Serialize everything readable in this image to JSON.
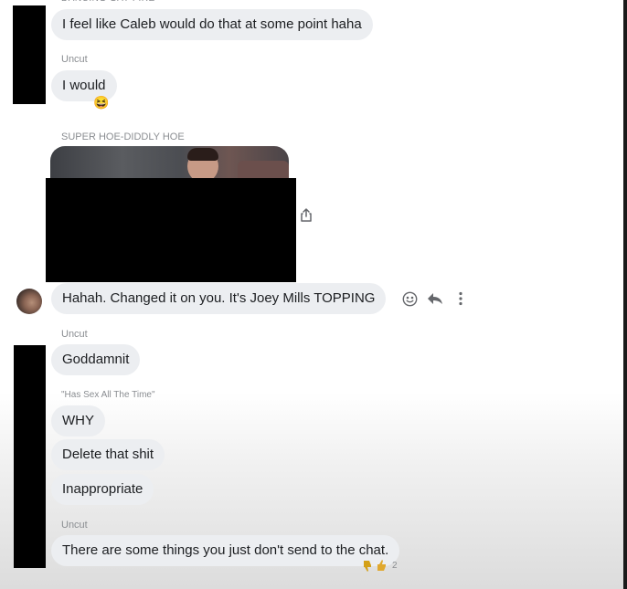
{
  "messages": {
    "m1": {
      "text": "I feel like Caleb would do that at some point haha"
    },
    "sender_uncut_1": "Uncut",
    "m2": {
      "text": "I would",
      "reaction": "😆"
    },
    "sender_super": "SUPER HOE-DIDDLY HOE",
    "m4": {
      "text": "Hahah. Changed it on you. It's Joey Mills TOPPING"
    },
    "sender_uncut_2": "Uncut",
    "m5": {
      "text": "Goddamnit"
    },
    "sender_has_sex": "\"Has Sex All The Time\"",
    "m6": {
      "text": "WHY"
    },
    "m7": {
      "text": "Delete that shit"
    },
    "m8": {
      "text": "Inappropriate"
    },
    "sender_uncut_3": "Uncut",
    "m9": {
      "text": "There are some things you just don't send to the chat.",
      "reaction_count": "2"
    }
  },
  "icons": {
    "share": "share-icon",
    "emoji": "smiley-icon",
    "reply": "reply-icon",
    "more": "more-icon"
  },
  "colors": {
    "bubble": "#eceef1",
    "sender": "#8a8d91",
    "redaction": "#000000"
  }
}
